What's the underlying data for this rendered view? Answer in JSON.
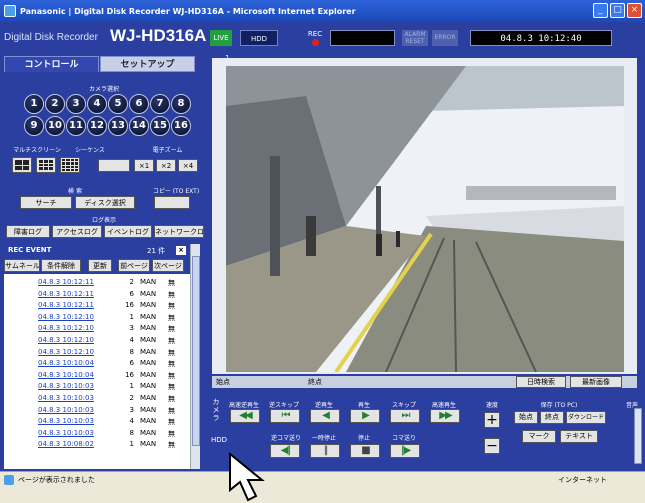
{
  "window": {
    "title": "Panasonic | Digital Disk Recorder WJ-HD316A - Microsoft Internet Explorer",
    "buttons": [
      "_",
      "□",
      "×"
    ]
  },
  "header": {
    "brand": "Digital Disk Recorder",
    "model": "WJ-HD316A",
    "live": "LIVE",
    "hdd": "HDD",
    "rec": "REC",
    "alarm_reset": "ALARM RESET",
    "error": "ERROR",
    "clock": "04.8.3  10:12:40"
  },
  "tabs": {
    "control": "コントロール",
    "setup": "セットアップ"
  },
  "camera_select": {
    "label": "カメラ選択",
    "cameras": [
      "1",
      "2",
      "3",
      "4",
      "5",
      "6",
      "7",
      "8",
      "9",
      "10",
      "11",
      "12",
      "13",
      "14",
      "15",
      "16"
    ]
  },
  "multiscreen": {
    "label": "マルチスクリーン"
  },
  "sequence": {
    "label": "シーケンス"
  },
  "ezoom": {
    "label": "電子ズーム",
    "buttons": [
      "×1",
      "×2",
      "×4"
    ]
  },
  "search": {
    "label": "検 索",
    "search_btn": "サーチ",
    "disk_btn": "ディスク選択"
  },
  "copy": {
    "label": "コピー (TO EXT)"
  },
  "logs": {
    "label": "ログ表示",
    "buttons": [
      "障害ログ",
      "アクセスログ",
      "イベントログ",
      "ネットワークログ"
    ]
  },
  "rec_event": {
    "title": "REC EVENT",
    "count": "21 件",
    "close": "×",
    "buttons": [
      "サムネール",
      "条件解除",
      "更新",
      "前ページ",
      "次ページ"
    ],
    "rows": [
      {
        "date": "04.8.3 10:12:11",
        "ch": "2",
        "mode": "MAN",
        "flag": "無"
      },
      {
        "date": "04.8.3 10:12:11",
        "ch": "6",
        "mode": "MAN",
        "flag": "無"
      },
      {
        "date": "04.8.3 10:12:11",
        "ch": "16",
        "mode": "MAN",
        "flag": "無"
      },
      {
        "date": "04.8.3 10:12:10",
        "ch": "1",
        "mode": "MAN",
        "flag": "無"
      },
      {
        "date": "04.8.3 10:12:10",
        "ch": "3",
        "mode": "MAN",
        "flag": "無"
      },
      {
        "date": "04.8.3 10:12:10",
        "ch": "4",
        "mode": "MAN",
        "flag": "無"
      },
      {
        "date": "04.8.3 10:12:10",
        "ch": "8",
        "mode": "MAN",
        "flag": "無"
      },
      {
        "date": "04.8.3 10:10:04",
        "ch": "6",
        "mode": "MAN",
        "flag": "無"
      },
      {
        "date": "04.8.3 10:10:04",
        "ch": "16",
        "mode": "MAN",
        "flag": "無"
      },
      {
        "date": "04.8.3 10:10:03",
        "ch": "1",
        "mode": "MAN",
        "flag": "無"
      },
      {
        "date": "04.8.3 10:10:03",
        "ch": "2",
        "mode": "MAN",
        "flag": "無"
      },
      {
        "date": "04.8.3 10:10:03",
        "ch": "3",
        "mode": "MAN",
        "flag": "無"
      },
      {
        "date": "04.8.3 10:10:03",
        "ch": "4",
        "mode": "MAN",
        "flag": "無"
      },
      {
        "date": "04.8.3 10:10:03",
        "ch": "8",
        "mode": "MAN",
        "flag": "無"
      },
      {
        "date": "04.8.3 10:08:02",
        "ch": "1",
        "mode": "MAN",
        "flag": "無"
      }
    ]
  },
  "video": {
    "channel": "1"
  },
  "playback": {
    "start": "始点",
    "end": "終点",
    "date_search": "日時検索",
    "latest": "最新画像",
    "camera": "カメラ",
    "hdd": "HDD",
    "fast_rev": "高速逆再生",
    "rev_skip": "逆スキップ",
    "reverse": "逆再生",
    "play": "再生",
    "skip": "スキップ",
    "fast_play": "高速再生",
    "frame_rev": "逆コマ送り",
    "pause": "一時停止",
    "stop": "停止",
    "frame_fwd": "コマ送り",
    "speed": "速度",
    "plus": "+",
    "minus": "−",
    "save": "保存 (TO PC)",
    "start_btn": "始点",
    "end_btn": "終点",
    "download": "ダウンロード",
    "mark": "マーク",
    "text": "テキスト",
    "audio": "音声"
  },
  "status": {
    "text": "ページが表示されました",
    "zone": "インターネット"
  }
}
